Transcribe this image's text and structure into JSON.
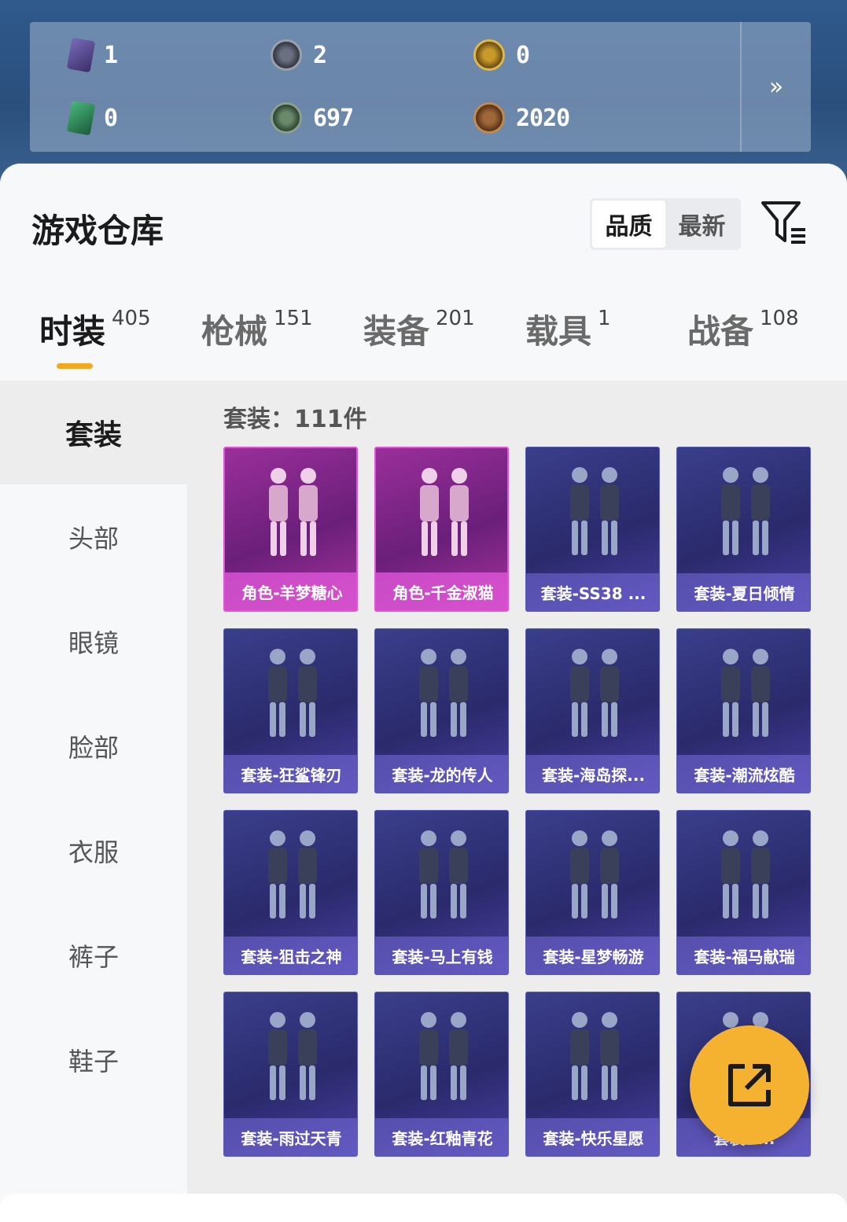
{
  "currencies": [
    {
      "icon": "purple-card-icon",
      "value": "1"
    },
    {
      "icon": "silver-coin-icon",
      "value": "2"
    },
    {
      "icon": "gold-coin-icon",
      "value": "0"
    },
    {
      "icon": "green-card-icon",
      "value": "0"
    },
    {
      "icon": "green-coin-icon",
      "value": "697"
    },
    {
      "icon": "bronze-coin-icon",
      "value": "2020"
    }
  ],
  "expand_label": "»",
  "title": "游戏仓库",
  "sort": {
    "quality": "品质",
    "newest": "最新"
  },
  "tabs": [
    {
      "label": "时装",
      "count": "405"
    },
    {
      "label": "枪械",
      "count": "151"
    },
    {
      "label": "装备",
      "count": "201"
    },
    {
      "label": "载具",
      "count": "1"
    },
    {
      "label": "战备",
      "count": "108"
    }
  ],
  "sidebar": [
    {
      "label": "套装"
    },
    {
      "label": "头部"
    },
    {
      "label": "眼镜"
    },
    {
      "label": "脸部"
    },
    {
      "label": "衣服"
    },
    {
      "label": "裤子"
    },
    {
      "label": "鞋子"
    }
  ],
  "count_label": "套装：111件",
  "items": [
    {
      "name": "角色-羊梦糖心",
      "rarity": "pink"
    },
    {
      "name": "角色-千金淑猫",
      "rarity": "pink"
    },
    {
      "name": "套装-SS38 ...",
      "rarity": "blue"
    },
    {
      "name": "套装-夏日倾情",
      "rarity": "blue"
    },
    {
      "name": "套装-狂鲨锋刃",
      "rarity": "blue"
    },
    {
      "name": "套装-龙的传人",
      "rarity": "blue"
    },
    {
      "name": "套装-海岛探...",
      "rarity": "blue"
    },
    {
      "name": "套装-潮流炫酷",
      "rarity": "blue"
    },
    {
      "name": "套装-狙击之神",
      "rarity": "blue"
    },
    {
      "name": "套装-马上有钱",
      "rarity": "blue"
    },
    {
      "name": "套装-星梦畅游",
      "rarity": "blue"
    },
    {
      "name": "套装-福马献瑞",
      "rarity": "blue"
    },
    {
      "name": "套装-雨过天青",
      "rarity": "blue"
    },
    {
      "name": "套装-红釉青花",
      "rarity": "blue"
    },
    {
      "name": "套装-快乐星愿",
      "rarity": "blue"
    },
    {
      "name": "套装- ...",
      "rarity": "blue"
    }
  ],
  "colors": {
    "accent": "#f4a623",
    "fab": "#f5b130",
    "pink_rarity": "#e054d5",
    "blue_rarity": "#5a5bb5"
  }
}
